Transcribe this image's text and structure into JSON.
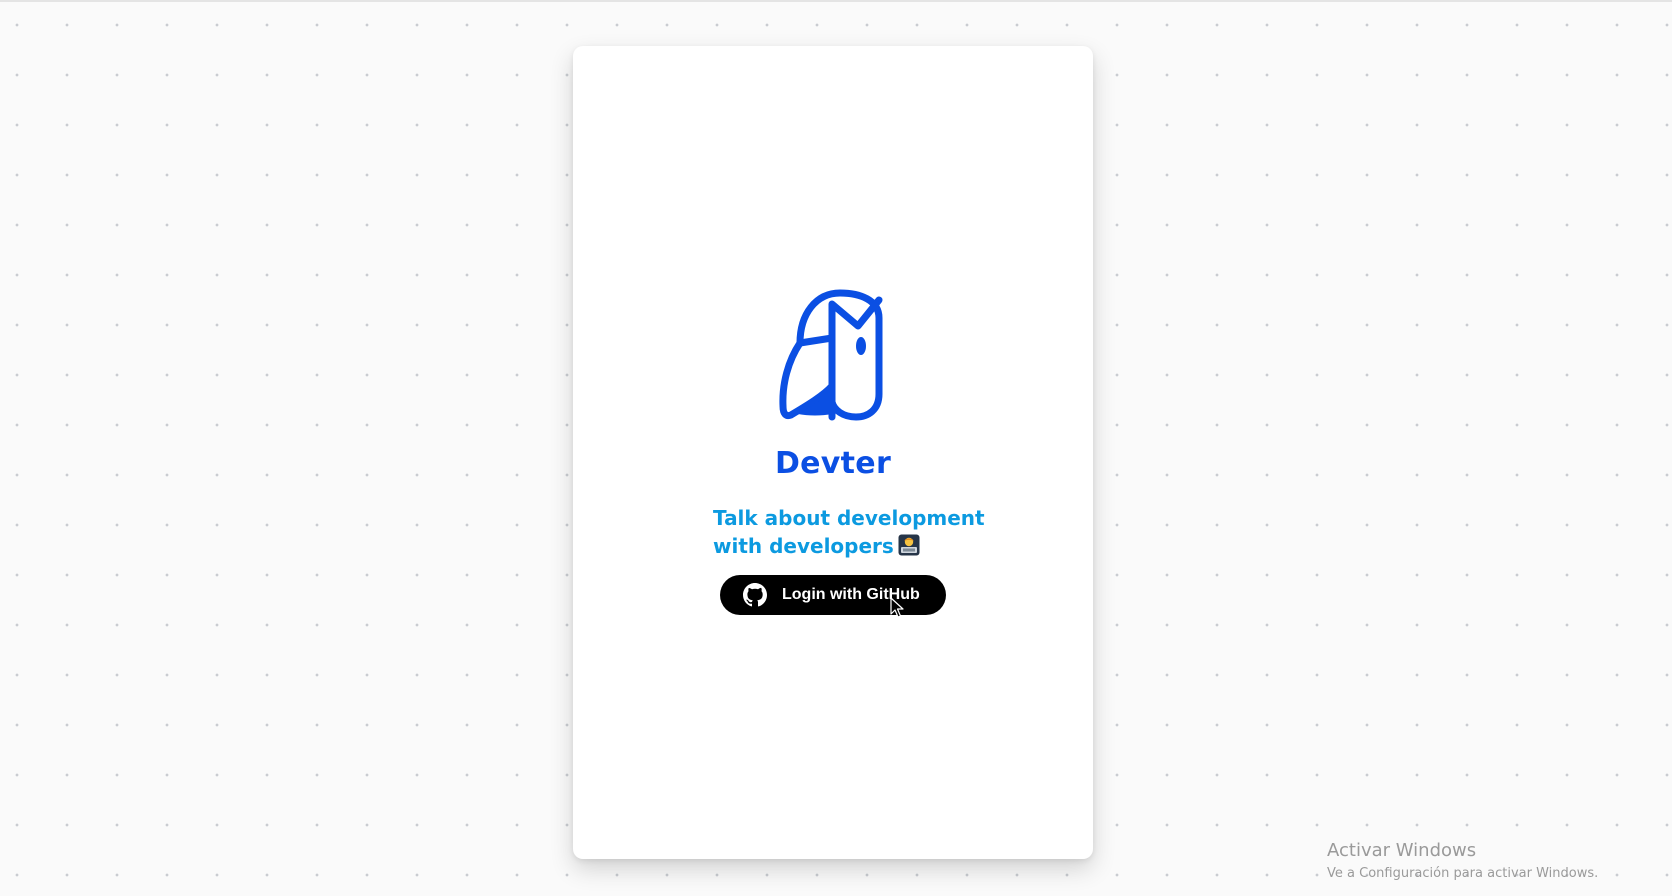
{
  "app": {
    "name": "Devter",
    "tagline_line1": "Talk about development",
    "tagline_line2": "with developers",
    "tagline_emoji": "technologist-emoji"
  },
  "login": {
    "label": "Login with GitHub",
    "icon": "github-icon"
  },
  "logo": {
    "icon": "devter-owl-logo",
    "color": "#0b4fe3"
  },
  "colors": {
    "brand": "#0b4fe3",
    "tagline": "#0c9ae0",
    "button_bg": "#000000",
    "button_text": "#ffffff"
  },
  "os_watermark": {
    "title": "Activar Windows",
    "subtitle": "Ve a Configuración para activar Windows."
  }
}
